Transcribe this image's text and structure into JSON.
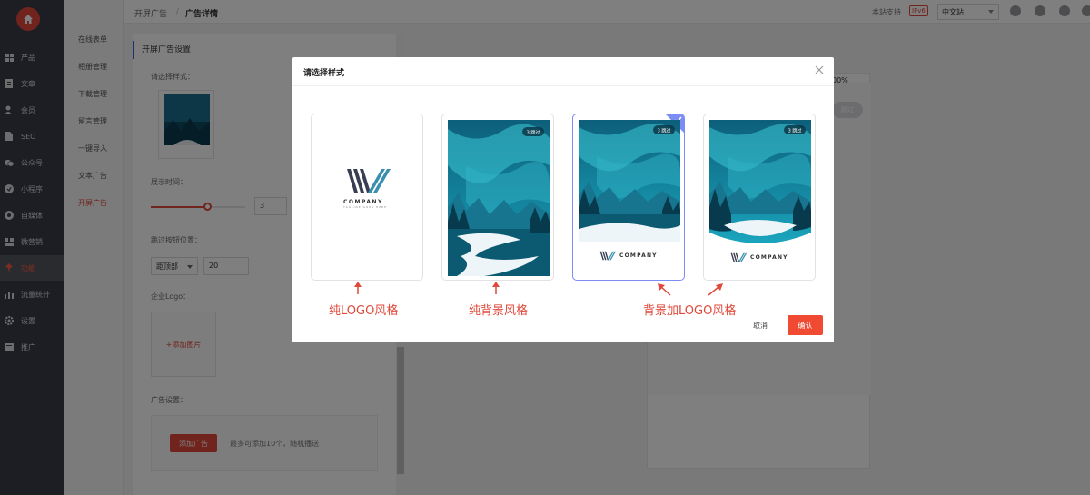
{
  "nav": {
    "items": [
      {
        "label": "产品",
        "icon": "grid-icon"
      },
      {
        "label": "文章",
        "icon": "document-icon"
      },
      {
        "label": "会员",
        "icon": "user-icon"
      },
      {
        "label": "SEO",
        "icon": "file-icon"
      },
      {
        "label": "公众号",
        "icon": "wechat-icon"
      },
      {
        "label": "小程序",
        "icon": "mini-program-icon"
      },
      {
        "label": "自媒体",
        "icon": "media-icon"
      },
      {
        "label": "微营销",
        "icon": "marketing-icon"
      },
      {
        "label": "功能",
        "icon": "pin-icon",
        "active": true
      },
      {
        "label": "流量统计",
        "icon": "chart-icon"
      },
      {
        "label": "设置",
        "icon": "gear-icon"
      },
      {
        "label": "推广",
        "icon": "promote-icon"
      }
    ]
  },
  "subnav": {
    "items": [
      "在线表单",
      "相册管理",
      "下载管理",
      "留言管理",
      "一键导入",
      "文本广告",
      "开屏广告"
    ]
  },
  "topbar": {
    "breadcrumb_parent": "开屏广告",
    "breadcrumb_sep": "/",
    "breadcrumb_current": "广告详情",
    "support_text": "本站支持",
    "ipv6": "IPv6",
    "language": "中文站"
  },
  "form": {
    "section_title": "开屏广告设置",
    "style_label": "请选择样式：",
    "display_time_label": "展示时间：",
    "display_time_value": "3",
    "display_time_fraction": 0.6,
    "skip_position_label": "跳过按钮位置：",
    "skip_position_value": "距顶部",
    "skip_position_offset": "20",
    "logo_label": "企业Logo：",
    "add_image": "+添加图片",
    "ad_settings_label": "广告设置：",
    "add_ad_button": "添加广告",
    "ad_hint": "最多可添加10个，随机播送"
  },
  "preview": {
    "percent": "00%",
    "skip": "跳过"
  },
  "modal": {
    "title": "请选择样式",
    "skip_badge": "3 跳过",
    "company": "COMPANY",
    "company_tagline": "TAGLINE GOES HERE",
    "selected_index": 2,
    "captions": {
      "logo_only": "纯LOGO风格",
      "background_only": "纯背景风格",
      "background_logo": "背景加LOGO风格"
    },
    "cancel": "取消",
    "confirm": "确认"
  },
  "colors": {
    "accent_red": "#e0483a",
    "selected_border": "#7b8cf2",
    "sidebar_bg": "#3a3c46"
  }
}
